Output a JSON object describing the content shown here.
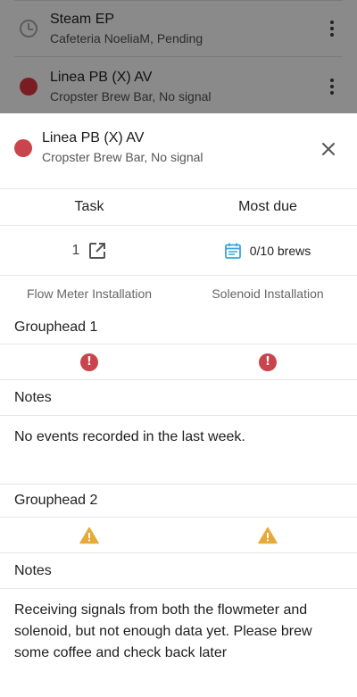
{
  "background_list": [
    {
      "title": "Steam EP",
      "subtitle": "Cafeteria NoeliaM, Pending",
      "icon": "clock-icon"
    },
    {
      "title": "Linea PB (X) AV",
      "subtitle": "Cropster Brew Bar, No signal",
      "icon": "status-dot"
    }
  ],
  "sheet": {
    "title": "Linea PB (X) AV",
    "subtitle": "Cropster Brew Bar, No signal",
    "status_color": "#c9444d",
    "columns": {
      "task": "Task",
      "most_due": "Most due"
    },
    "task_count": "1",
    "most_due_value": "0/10 brews",
    "task_name": "Flow Meter Installation",
    "most_due_name": "Solenoid Installation",
    "groups": [
      {
        "title": "Grouphead 1",
        "status": "error",
        "notes_label": "Notes",
        "notes": "No events recorded in the last week."
      },
      {
        "title": "Grouphead 2",
        "status": "warning",
        "notes_label": "Notes",
        "notes": "Receiving signals from both the flowmeter and solenoid, but not enough data yet. Please brew some coffee and check back later"
      }
    ]
  },
  "colors": {
    "error": "#c9444d",
    "warning": "#e8a93b",
    "accent": "#3aa6d6"
  }
}
